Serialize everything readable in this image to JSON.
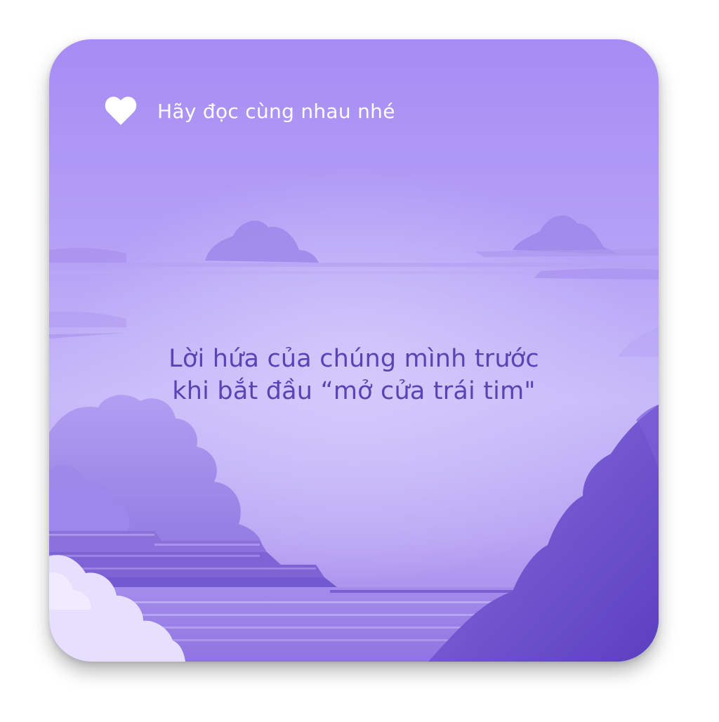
{
  "header": {
    "icon": "heart-icon",
    "text": "Hãy đọc cùng nhau nhé"
  },
  "quote": {
    "line1": "Lời hứa của chúng mình trước",
    "line2": "khi bắt đầu “mở cửa trái tim\""
  },
  "colors": {
    "card_top": "#a68cf4",
    "card_center": "#c8baf9",
    "card_bottom": "#9a80e6",
    "quote_text": "#5a43b4",
    "header_text": "#ffffff"
  }
}
